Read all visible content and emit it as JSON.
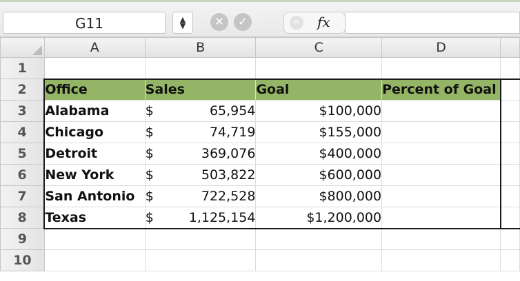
{
  "formula_bar": {
    "name_box": "G11",
    "stepper_glyph": "⬍",
    "cancel_icon": "✕",
    "enter_icon": "✓",
    "fx_label": "fx",
    "formula_value": ""
  },
  "grid": {
    "columns": [
      "A",
      "B",
      "C",
      "D"
    ],
    "rows": [
      {
        "num": "1",
        "a": "",
        "b_dollar": "",
        "b_amount": "",
        "c": "",
        "d": ""
      },
      {
        "num": "2",
        "a": "Office",
        "b_dollar": "Sales",
        "b_amount": "",
        "c": "Goal",
        "d": "Percent of Goal"
      },
      {
        "num": "3",
        "a": "Alabama",
        "b_dollar": "$",
        "b_amount": "65,954",
        "c": "$100,000",
        "d": ""
      },
      {
        "num": "4",
        "a": "Chicago",
        "b_dollar": "$",
        "b_amount": "74,719",
        "c": "$155,000",
        "d": ""
      },
      {
        "num": "5",
        "a": "Detroit",
        "b_dollar": "$",
        "b_amount": "369,076",
        "c": "$400,000",
        "d": ""
      },
      {
        "num": "6",
        "a": "New York",
        "b_dollar": "$",
        "b_amount": "503,822",
        "c": "$600,000",
        "d": ""
      },
      {
        "num": "7",
        "a": "San Antonio",
        "b_dollar": "$",
        "b_amount": "722,528",
        "c": "$800,000",
        "d": ""
      },
      {
        "num": "8",
        "a": "Texas",
        "b_dollar": "$",
        "b_amount": "1,125,154",
        "c": "$1,200,000",
        "d": ""
      },
      {
        "num": "9",
        "a": "",
        "b_dollar": "",
        "b_amount": "",
        "c": "",
        "d": ""
      },
      {
        "num": "10",
        "a": "",
        "b_dollar": "",
        "b_amount": "",
        "c": "",
        "d": ""
      }
    ]
  },
  "colors": {
    "header_fill": "#93b565",
    "outline": "#1a1a1a"
  }
}
